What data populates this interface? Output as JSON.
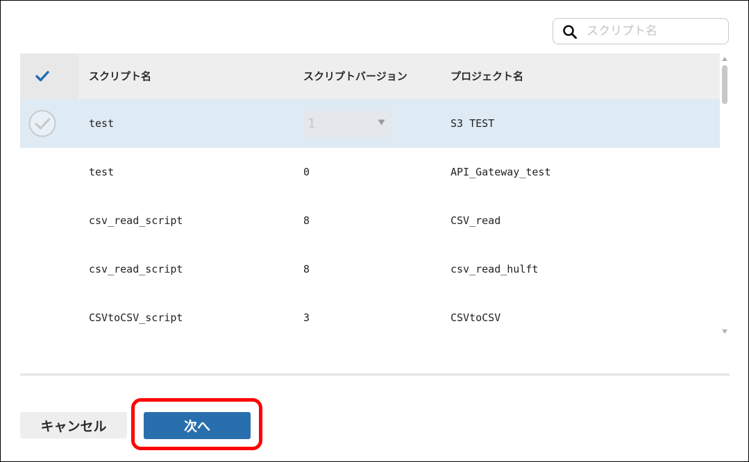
{
  "search": {
    "icon": "search-icon",
    "placeholder": "スクリプト名",
    "value": ""
  },
  "table": {
    "header_check_icon": "checkmark-icon",
    "columns": [
      "スクリプト名",
      "スクリプトバージョン",
      "プロジェクト名"
    ],
    "rows": [
      {
        "script_name": "test",
        "version": "1",
        "project": "S3 TEST",
        "selected": true,
        "version_is_dropdown": true
      },
      {
        "script_name": "test",
        "version": "0",
        "project": "API_Gateway_test",
        "selected": false
      },
      {
        "script_name": "csv_read_script",
        "version": "8",
        "project": "CSV_read",
        "selected": false
      },
      {
        "script_name": "csv_read_script",
        "version": "8",
        "project": "csv_read_hulft",
        "selected": false
      },
      {
        "script_name": "CSVtoCSV_script",
        "version": "3",
        "project": "CSVtoCSV",
        "selected": false
      }
    ]
  },
  "footer": {
    "cancel_label": "キャンセル",
    "next_label": "次へ"
  },
  "colors": {
    "accent": "#2a6fad",
    "check_blue": "#1f6db0",
    "selected_row": "#deeaf4",
    "header_bg": "#eeeeee",
    "highlight": "#ff0000"
  }
}
